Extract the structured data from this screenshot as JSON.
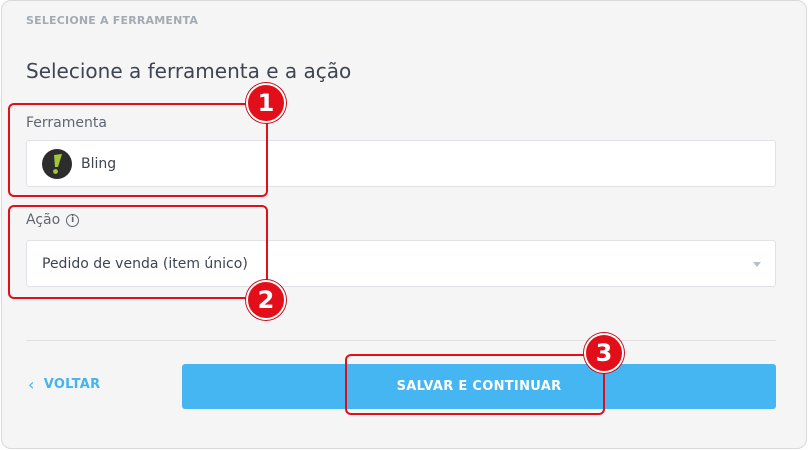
{
  "section_label": "SELECIONE A FERRAMENTA",
  "title": "Selecione a ferramenta e a ação",
  "tool_field": {
    "label": "Ferramenta",
    "value": "Bling",
    "icon": "bling-logo-icon"
  },
  "action_field": {
    "label": "Ação",
    "info_icon": "info-icon",
    "info_glyph": "i",
    "value": "Pedido de venda (item único)"
  },
  "buttons": {
    "back_chevron": "‹",
    "back_label": "VOLTAR",
    "save_label": "SALVAR E CONTINUAR"
  },
  "annotations": {
    "markers": [
      "1",
      "2",
      "3"
    ],
    "color": "#e20f1b"
  },
  "colors": {
    "accent": "#45b6f2",
    "link": "#43b4ee",
    "logo_green": "#a4c639"
  }
}
